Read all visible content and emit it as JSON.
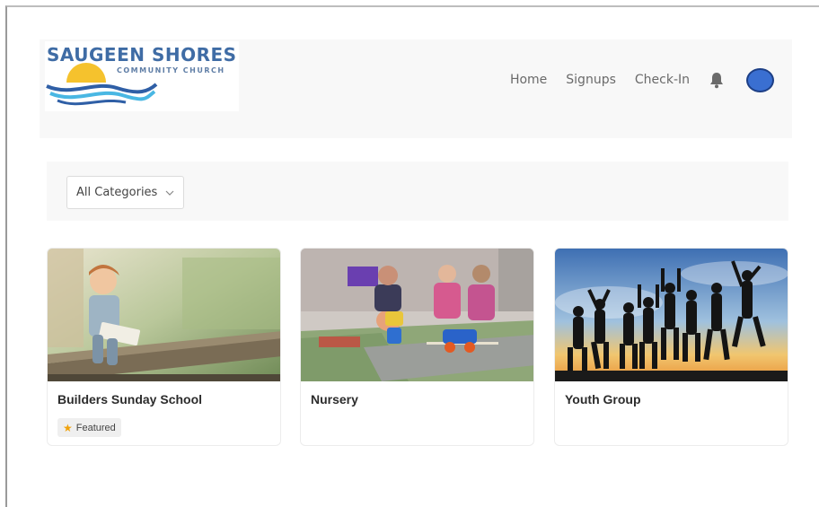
{
  "logo": {
    "title": "SAUGEEN SHORES",
    "subtitle": "COMMUNITY CHURCH"
  },
  "nav": {
    "items": [
      "Home",
      "Signups",
      "Check-In"
    ],
    "icons": [
      "bell-icon",
      "avatar"
    ]
  },
  "filter": {
    "selected": "All Categories"
  },
  "cards": [
    {
      "title": "Builders Sunday School",
      "badge": "Featured"
    },
    {
      "title": "Nursery"
    },
    {
      "title": "Youth Group"
    }
  ],
  "colors": {
    "brand": "#3f6ca5",
    "sun": "#f5c22d",
    "avatar": "#3a6fd1",
    "star": "#f0a20b"
  }
}
